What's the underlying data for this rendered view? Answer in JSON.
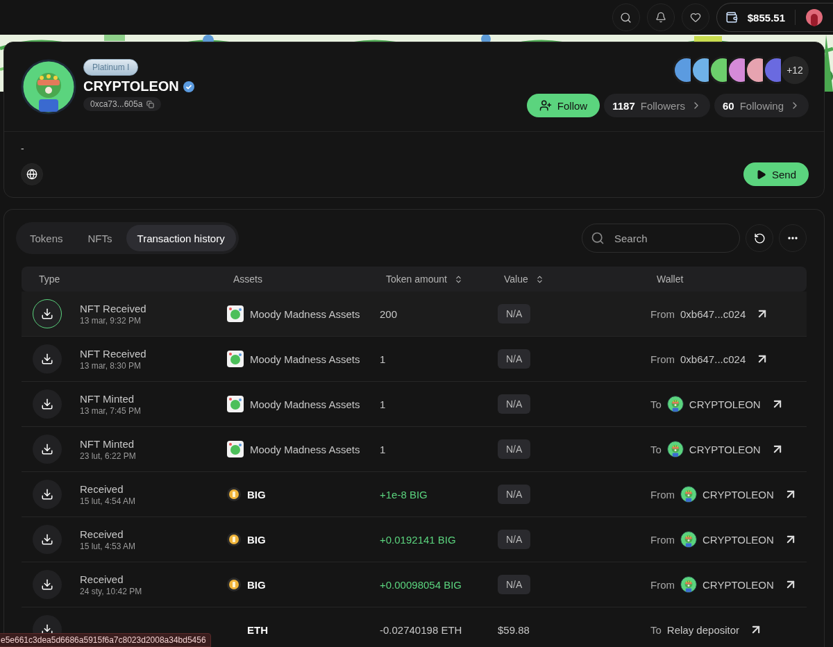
{
  "top_bar": {
    "balance": "$855.51"
  },
  "profile": {
    "tier": "Platinum I",
    "name": "CRYPTOLEON",
    "verified": true,
    "address": "0xca73...605a",
    "bio": "-",
    "badges": [
      {
        "color": "#5b9be0"
      },
      {
        "color": "#6fb2e8"
      },
      {
        "color": "#6ccf6c"
      },
      {
        "color": "#d58ad8"
      },
      {
        "color": "#e6a3b0"
      },
      {
        "color": "#6a6ae0"
      }
    ],
    "more_badges": "+12",
    "follow_label": "Follow",
    "followers_count": "1187",
    "followers_label": "Followers",
    "following_count": "60",
    "following_label": "Following",
    "send_label": "Send"
  },
  "tabs": [
    {
      "label": "Tokens",
      "selected": false
    },
    {
      "label": "NFTs",
      "selected": false
    },
    {
      "label": "Transaction history",
      "selected": true
    }
  ],
  "search": {
    "placeholder": "Search"
  },
  "table": {
    "columns": [
      {
        "label": "Type",
        "sortable": false
      },
      {
        "label": "Assets",
        "sortable": false
      },
      {
        "label": "Token amount",
        "sortable": true
      },
      {
        "label": "Value",
        "sortable": true
      },
      {
        "label": "Wallet",
        "sortable": false
      }
    ],
    "rows": [
      {
        "hovered": true,
        "type": "NFT Received",
        "time": "13 mar, 9:32 PM",
        "asset": {
          "kind": "nft",
          "name": "Moody Madness Assets"
        },
        "amount": "200",
        "positive": false,
        "value": {
          "kind": "badge",
          "text": "N/A"
        },
        "direction": "From",
        "wallet": {
          "kind": "address",
          "name": "0xb647...c024"
        }
      },
      {
        "hovered": false,
        "type": "NFT Received",
        "time": "13 mar, 8:30 PM",
        "asset": {
          "kind": "nft",
          "name": "Moody Madness Assets"
        },
        "amount": "1",
        "positive": false,
        "value": {
          "kind": "badge",
          "text": "N/A"
        },
        "direction": "From",
        "wallet": {
          "kind": "address",
          "name": "0xb647...c024"
        }
      },
      {
        "hovered": false,
        "type": "NFT Minted",
        "time": "13 mar, 7:45 PM",
        "asset": {
          "kind": "nft",
          "name": "Moody Madness Assets"
        },
        "amount": "1",
        "positive": false,
        "value": {
          "kind": "badge",
          "text": "N/A"
        },
        "direction": "To",
        "wallet": {
          "kind": "profile",
          "name": "CRYPTOLEON"
        }
      },
      {
        "hovered": false,
        "type": "NFT Minted",
        "time": "23 lut, 6:22 PM",
        "asset": {
          "kind": "nft",
          "name": "Moody Madness Assets"
        },
        "amount": "1",
        "positive": false,
        "value": {
          "kind": "badge",
          "text": "N/A"
        },
        "direction": "To",
        "wallet": {
          "kind": "profile",
          "name": "CRYPTOLEON"
        }
      },
      {
        "hovered": false,
        "type": "Received",
        "time": "15 lut, 4:54 AM",
        "asset": {
          "kind": "coin",
          "name": "BIG"
        },
        "amount": "+1e-8 BIG",
        "positive": true,
        "value": {
          "kind": "badge",
          "text": "N/A"
        },
        "direction": "From",
        "wallet": {
          "kind": "profile",
          "name": "CRYPTOLEON"
        }
      },
      {
        "hovered": false,
        "type": "Received",
        "time": "15 lut, 4:53 AM",
        "asset": {
          "kind": "coin",
          "name": "BIG"
        },
        "amount": "+0.0192141 BIG",
        "positive": true,
        "value": {
          "kind": "badge",
          "text": "N/A"
        },
        "direction": "From",
        "wallet": {
          "kind": "profile",
          "name": "CRYPTOLEON"
        }
      },
      {
        "hovered": false,
        "type": "Received",
        "time": "24 sty, 10:42 PM",
        "asset": {
          "kind": "coin",
          "name": "BIG"
        },
        "amount": "+0.00098054 BIG",
        "positive": true,
        "value": {
          "kind": "badge",
          "text": "N/A"
        },
        "direction": "From",
        "wallet": {
          "kind": "profile",
          "name": "CRYPTOLEON"
        }
      },
      {
        "hovered": false,
        "asset": {
          "kind": "hidden",
          "name": "ETH"
        },
        "amount": "-0.02740198 ETH",
        "positive": false,
        "value": {
          "kind": "plain",
          "text": "$59.88"
        },
        "direction": "To",
        "wallet": {
          "kind": "address",
          "name": "Relay depositor"
        }
      }
    ]
  },
  "status_link": "e5e661c3dea5d6686a5915f6a7c8023d2008a34bd5456"
}
